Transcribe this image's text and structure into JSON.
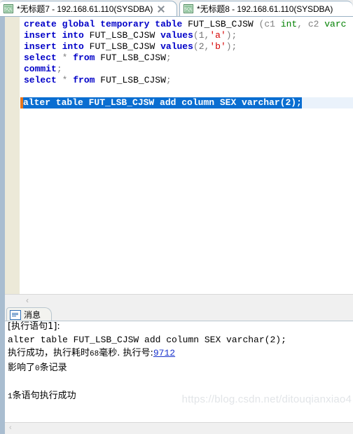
{
  "window": {
    "tabs": [
      {
        "title": "*无标题7 - 192.168.61.110(SYSDBA)",
        "icon": "sql-file-icon",
        "active": true,
        "closable": true
      },
      {
        "title": "*无标题8 - 192.168.61.110(SYSDBA)",
        "icon": "sql-file-icon",
        "active": false,
        "closable": false
      }
    ]
  },
  "editor": {
    "lines": [
      {
        "tokens": [
          {
            "t": "create",
            "c": "kw"
          },
          {
            "t": " ",
            "c": "ident"
          },
          {
            "t": "global",
            "c": "kw"
          },
          {
            "t": " ",
            "c": "ident"
          },
          {
            "t": "temporary",
            "c": "kw"
          },
          {
            "t": " ",
            "c": "ident"
          },
          {
            "t": "table",
            "c": "kw"
          },
          {
            "t": " ",
            "c": "ident"
          },
          {
            "t": "FUT_LSB_CJSW",
            "c": "ident"
          },
          {
            "t": " ",
            "c": "ident"
          },
          {
            "t": "(",
            "c": "pun"
          },
          {
            "t": "c1",
            "c": "pun"
          },
          {
            "t": " ",
            "c": "ident"
          },
          {
            "t": "int",
            "c": "typ"
          },
          {
            "t": ",",
            "c": "pun"
          },
          {
            "t": " ",
            "c": "ident"
          },
          {
            "t": "c2",
            "c": "pun"
          },
          {
            "t": " ",
            "c": "ident"
          },
          {
            "t": "varc",
            "c": "typ"
          }
        ]
      },
      {
        "tokens": [
          {
            "t": "insert",
            "c": "kw"
          },
          {
            "t": " ",
            "c": "ident"
          },
          {
            "t": "into",
            "c": "kw"
          },
          {
            "t": " ",
            "c": "ident"
          },
          {
            "t": "FUT_LSB_CJSW",
            "c": "ident"
          },
          {
            "t": " ",
            "c": "ident"
          },
          {
            "t": "values",
            "c": "kw"
          },
          {
            "t": "(",
            "c": "pun"
          },
          {
            "t": "1",
            "c": "num"
          },
          {
            "t": ",",
            "c": "pun"
          },
          {
            "t": "'a'",
            "c": "str"
          },
          {
            "t": ");",
            "c": "pun"
          }
        ]
      },
      {
        "tokens": [
          {
            "t": "insert",
            "c": "kw"
          },
          {
            "t": " ",
            "c": "ident"
          },
          {
            "t": "into",
            "c": "kw"
          },
          {
            "t": " ",
            "c": "ident"
          },
          {
            "t": "FUT_LSB_CJSW",
            "c": "ident"
          },
          {
            "t": " ",
            "c": "ident"
          },
          {
            "t": "values",
            "c": "kw"
          },
          {
            "t": "(",
            "c": "pun"
          },
          {
            "t": "2",
            "c": "num"
          },
          {
            "t": ",",
            "c": "pun"
          },
          {
            "t": "'b'",
            "c": "str"
          },
          {
            "t": ");",
            "c": "pun"
          }
        ]
      },
      {
        "tokens": [
          {
            "t": "select",
            "c": "kw"
          },
          {
            "t": " ",
            "c": "ident"
          },
          {
            "t": "*",
            "c": "pun"
          },
          {
            "t": " ",
            "c": "ident"
          },
          {
            "t": "from",
            "c": "kw"
          },
          {
            "t": " ",
            "c": "ident"
          },
          {
            "t": "FUT_LSB_CJSW",
            "c": "ident"
          },
          {
            "t": ";",
            "c": "pun"
          }
        ]
      },
      {
        "tokens": [
          {
            "t": "commit",
            "c": "kw"
          },
          {
            "t": ";",
            "c": "pun"
          }
        ]
      },
      {
        "tokens": [
          {
            "t": "select",
            "c": "kw"
          },
          {
            "t": " ",
            "c": "ident"
          },
          {
            "t": "*",
            "c": "pun"
          },
          {
            "t": " ",
            "c": "ident"
          },
          {
            "t": "from",
            "c": "kw"
          },
          {
            "t": " ",
            "c": "ident"
          },
          {
            "t": "FUT_LSB_CJSW",
            "c": "ident"
          },
          {
            "t": ";",
            "c": "pun"
          }
        ]
      },
      {
        "tokens": []
      },
      {
        "current": true,
        "selected_text": "alter table FUT_LSB_CJSW add column SEX varchar(2);"
      }
    ],
    "scroll_left_arrow": "‹"
  },
  "messages": {
    "tab_label": "消息",
    "tab_icon": "message-lines-icon",
    "lines": [
      {
        "text": "[执行语句1]:",
        "kind": "cn"
      },
      {
        "text": "alter table FUT_LSB_CJSW add column SEX varchar(2);",
        "kind": "mono"
      },
      {
        "kind": "result",
        "prefix": "执行成功，执行耗时",
        "ms": "68",
        "mid": "毫秒. 执行号:",
        "exec_no": "9712"
      },
      {
        "kind": "affected",
        "pre": "影响了",
        "count": "0",
        "post": "条记录"
      },
      {
        "text": "",
        "kind": "blank"
      },
      {
        "kind": "summary",
        "count": "1",
        "post": "条语句执行成功"
      }
    ],
    "scroll_left_arrow": "‹"
  },
  "watermark": "https://blog.csdn.net/ditouqianxiao4"
}
